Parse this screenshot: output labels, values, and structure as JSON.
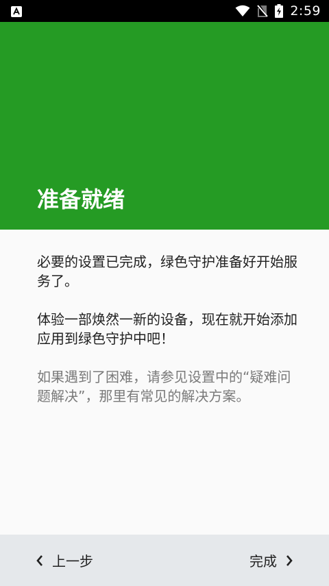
{
  "status_bar": {
    "time": "2:59",
    "icons": [
      "keyboard-a-icon",
      "wifi-icon",
      "no-sim-icon",
      "battery-charging-icon"
    ]
  },
  "header": {
    "title": "准备就绪",
    "background_color": "#259b24"
  },
  "content": {
    "paragraph_1": "必要的设置已完成，绿色守护准备好开始服务了。",
    "paragraph_2": "体验一部焕然一新的设备，现在就开始添加应用到绿色守护中吧！",
    "paragraph_3": "如果遇到了困难，请参见设置中的“疑难问题解决”，那里有常见的解决方案。"
  },
  "navigation": {
    "back_label": "上一步",
    "done_label": "完成"
  }
}
